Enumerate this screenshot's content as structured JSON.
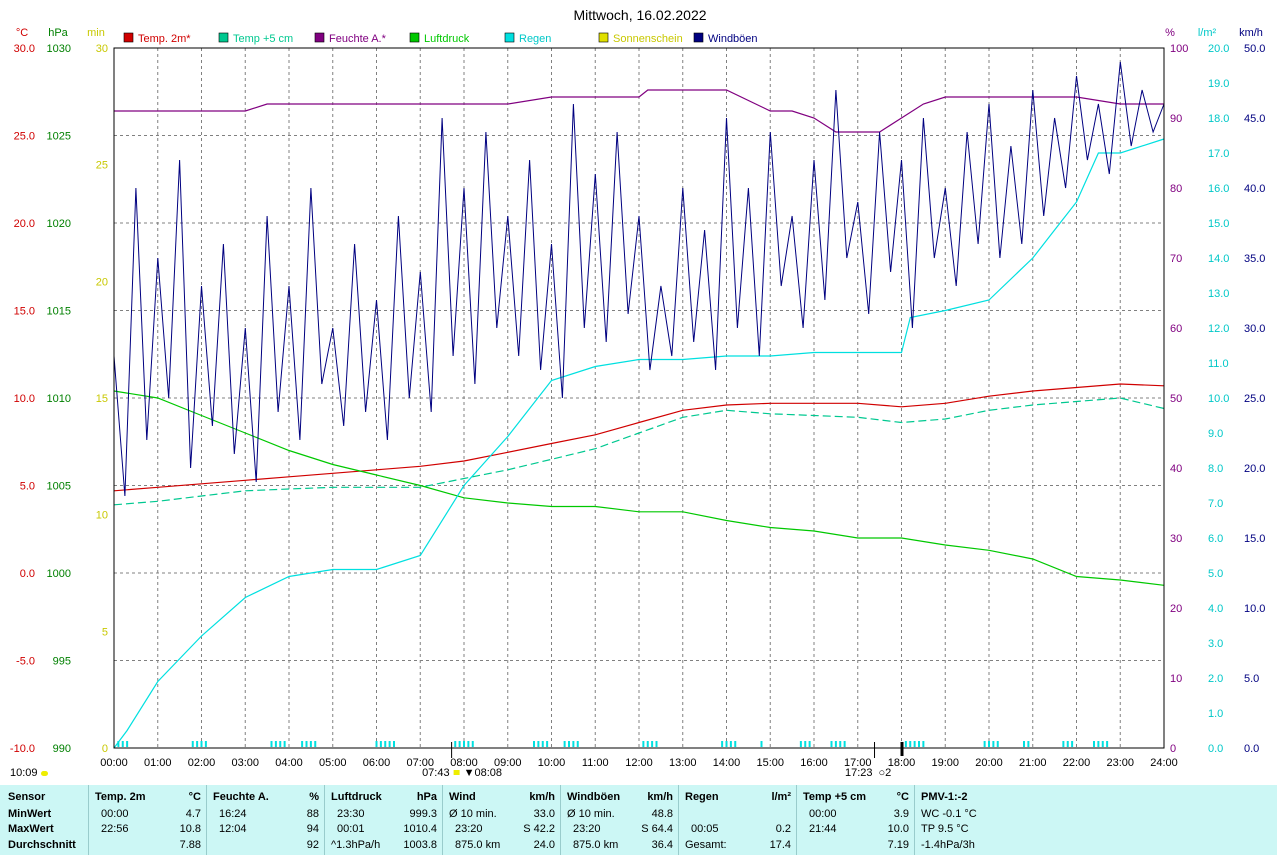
{
  "chart_data": {
    "type": "line",
    "title": "Mittwoch, 16.02.2022",
    "x_ticks": [
      "00:00",
      "01:00",
      "02:00",
      "03:00",
      "04:00",
      "05:00",
      "06:00",
      "07:00",
      "08:00",
      "09:00",
      "10:00",
      "11:00",
      "12:00",
      "13:00",
      "14:00",
      "15:00",
      "16:00",
      "17:00",
      "18:00",
      "19:00",
      "20:00",
      "21:00",
      "22:00",
      "23:00",
      "24:00"
    ],
    "axes": {
      "temp": {
        "unit": "°C",
        "ticks": [
          "30.0",
          "25.0",
          "20.0",
          "15.0",
          "10.0",
          "5.0",
          "0.0",
          "-5.0",
          "-10.0"
        ],
        "range": [
          -10,
          30
        ],
        "color": "#d00000"
      },
      "pressure": {
        "unit": "hPa",
        "ticks": [
          "1030",
          "1025",
          "1020",
          "1015",
          "1010",
          "1005",
          "1000",
          "995",
          "990"
        ],
        "range": [
          990,
          1030
        ],
        "color": "#008000"
      },
      "sun": {
        "unit": "min",
        "ticks": [
          "30",
          "25",
          "20",
          "15",
          "10",
          "5",
          "0"
        ],
        "range": [
          0,
          30
        ],
        "color": "#c8c800"
      },
      "humidity": {
        "unit": "%",
        "ticks": [
          "100",
          "90",
          "80",
          "70",
          "60",
          "50",
          "40",
          "30",
          "20",
          "10",
          "0"
        ],
        "range": [
          0,
          100
        ],
        "color": "#800080"
      },
      "rain": {
        "unit": "l/m²",
        "ticks": [
          "20.0",
          "19.0",
          "18.0",
          "17.0",
          "16.0",
          "15.0",
          "14.0",
          "13.0",
          "12.0",
          "11.0",
          "10.0",
          "9.0",
          "8.0",
          "7.0",
          "6.0",
          "5.0",
          "4.0",
          "3.0",
          "2.0",
          "1.0",
          "0.0"
        ],
        "range": [
          0,
          20
        ],
        "color": "#00c8c8"
      },
      "wind": {
        "unit": "km/h",
        "ticks": [
          "50.0",
          "45.0",
          "40.0",
          "35.0",
          "30.0",
          "25.0",
          "20.0",
          "15.0",
          "10.0",
          "5.0",
          "0.0"
        ],
        "range": [
          0,
          50
        ],
        "color": "#000080"
      }
    },
    "legend": [
      {
        "name": "Temp. 2m*",
        "color": "#d00000"
      },
      {
        "name": "Temp +5 cm",
        "color": "#00c890"
      },
      {
        "name": "Feuchte A.*",
        "color": "#800080"
      },
      {
        "name": "Luftdruck",
        "color": "#00c800"
      },
      {
        "name": "Regen",
        "color": "#00e0e0"
      },
      {
        "name": "Sonnenschein",
        "color": "#e0e000"
      },
      {
        "name": "Windböen",
        "color": "#000080"
      }
    ],
    "series": [
      {
        "name": "Temp. 2m*",
        "axis": "temp",
        "x": [
          0,
          1,
          2,
          3,
          4,
          5,
          6,
          7,
          8,
          9,
          10,
          11,
          12,
          13,
          14,
          15,
          16,
          17,
          18,
          19,
          20,
          21,
          22,
          23,
          24
        ],
        "values": [
          4.7,
          4.9,
          5.1,
          5.3,
          5.5,
          5.7,
          5.9,
          6.1,
          6.4,
          6.9,
          7.4,
          7.9,
          8.6,
          9.3,
          9.6,
          9.7,
          9.7,
          9.7,
          9.5,
          9.7,
          10.1,
          10.4,
          10.6,
          10.8,
          10.7
        ]
      },
      {
        "name": "Temp +5 cm",
        "axis": "temp",
        "x": [
          0,
          1,
          2,
          3,
          4,
          5,
          6,
          7,
          8,
          9,
          10,
          11,
          12,
          13,
          14,
          15,
          16,
          17,
          18,
          19,
          20,
          21,
          22,
          23,
          24
        ],
        "values": [
          3.9,
          4.1,
          4.4,
          4.7,
          4.8,
          4.9,
          4.9,
          4.9,
          5.4,
          5.9,
          6.5,
          7.1,
          8.0,
          8.9,
          9.3,
          9.1,
          9.0,
          8.9,
          8.6,
          8.8,
          9.3,
          9.6,
          9.8,
          10.0,
          9.4
        ]
      },
      {
        "name": "Feuchte A.*",
        "axis": "humidity",
        "x": [
          0,
          1,
          2,
          3,
          3.5,
          4,
          5,
          6,
          7,
          8,
          9,
          10,
          11,
          12,
          12.2,
          13,
          14,
          15,
          15.5,
          16,
          16.5,
          17,
          17.5,
          18,
          18.5,
          19,
          20,
          21,
          22,
          23,
          24
        ],
        "values": [
          91,
          91,
          91,
          91,
          92,
          92,
          92,
          92,
          92,
          92,
          92,
          93,
          93,
          93,
          94,
          94,
          94,
          91,
          91,
          90,
          88,
          88,
          88,
          90,
          92,
          93,
          93,
          93,
          93,
          92,
          92
        ]
      },
      {
        "name": "Luftdruck",
        "axis": "pressure",
        "x": [
          0,
          1,
          2,
          3,
          4,
          5,
          6,
          7,
          8,
          9,
          10,
          11,
          12,
          13,
          14,
          15,
          16,
          17,
          18,
          19,
          20,
          21,
          22,
          23,
          24
        ],
        "values": [
          1010.4,
          1010.0,
          1009.0,
          1008.0,
          1007.0,
          1006.2,
          1005.6,
          1005.0,
          1004.3,
          1004.0,
          1003.8,
          1003.8,
          1003.5,
          1003.5,
          1003.0,
          1002.6,
          1002.4,
          1002.0,
          1002.0,
          1001.6,
          1001.3,
          1000.8,
          999.8,
          999.6,
          999.3
        ]
      },
      {
        "name": "Regen",
        "axis": "rain",
        "x": [
          0,
          0.3,
          1,
          2,
          3,
          4,
          5,
          6,
          7,
          8,
          9,
          10,
          11,
          12,
          13,
          14,
          15,
          16,
          17,
          18,
          18.2,
          19,
          20,
          21,
          21.5,
          22,
          22.5,
          23,
          24
        ],
        "values": [
          0,
          0.5,
          1.9,
          3.2,
          4.3,
          4.9,
          5.1,
          5.1,
          5.5,
          7.5,
          8.9,
          10.5,
          10.9,
          11.1,
          11.1,
          11.2,
          11.2,
          11.3,
          11.3,
          11.3,
          12.3,
          12.5,
          12.8,
          14.0,
          14.8,
          15.6,
          17.0,
          17.0,
          17.4
        ]
      },
      {
        "name": "Windböen",
        "axis": "wind",
        "x": [
          0,
          0.25,
          0.5,
          0.75,
          1,
          1.25,
          1.5,
          1.75,
          2,
          2.25,
          2.5,
          2.75,
          3,
          3.25,
          3.5,
          3.75,
          4,
          4.25,
          4.5,
          4.75,
          5,
          5.25,
          5.5,
          5.75,
          6,
          6.25,
          6.5,
          6.75,
          7,
          7.25,
          7.5,
          7.75,
          8,
          8.25,
          8.5,
          8.75,
          9,
          9.25,
          9.5,
          9.75,
          10,
          10.25,
          10.5,
          10.75,
          11,
          11.25,
          11.5,
          11.75,
          12,
          12.25,
          12.5,
          12.75,
          13,
          13.25,
          13.5,
          13.75,
          14,
          14.25,
          14.5,
          14.75,
          15,
          15.25,
          15.5,
          15.75,
          16,
          16.25,
          16.5,
          16.75,
          17,
          17.25,
          17.5,
          17.75,
          18,
          18.25,
          18.5,
          18.75,
          19,
          19.25,
          19.5,
          19.75,
          20,
          20.25,
          20.5,
          20.75,
          21,
          21.25,
          21.5,
          21.75,
          22,
          22.25,
          22.5,
          22.75,
          23,
          23.25,
          23.5,
          23.75,
          24
        ],
        "values": [
          28,
          18,
          40,
          22,
          35,
          25,
          42,
          20,
          33,
          23,
          36,
          21,
          30,
          19,
          38,
          24,
          33,
          22,
          40,
          26,
          30,
          23,
          36,
          24,
          32,
          22,
          38,
          25,
          34,
          24,
          45,
          28,
          40,
          26,
          44,
          30,
          38,
          28,
          42,
          27,
          36,
          25,
          46,
          30,
          41,
          29,
          44,
          31,
          38,
          27,
          33,
          28,
          40,
          29,
          37,
          27,
          45,
          30,
          40,
          28,
          44,
          33,
          38,
          30,
          42,
          32,
          47,
          35,
          39,
          31,
          44,
          34,
          42,
          30,
          45,
          35,
          40,
          33,
          44,
          36,
          46,
          35,
          43,
          36,
          47,
          38,
          45,
          40,
          48,
          42,
          46,
          41,
          49,
          43,
          47,
          44,
          46
        ]
      }
    ],
    "sun_ticks": {
      "sunrise": "07:43",
      "sunset": "17:23"
    },
    "sun_marker_labels": {
      "left": "▼08:08",
      "right": "○2"
    }
  },
  "corner_time": "10:09",
  "stats": {
    "labels": {
      "sensor": "Sensor",
      "min": "MinWert",
      "max": "MaxWert",
      "avg": "Durchschnitt"
    },
    "temp": {
      "h": "Temp. 2m",
      "u": "°C",
      "min_t": "00:00",
      "min_v": "4.7",
      "max_t": "22:56",
      "max_v": "10.8",
      "avg": "7.88"
    },
    "hum": {
      "h": "Feuchte A.",
      "u": "%",
      "min_t": "16:24",
      "min_v": "88",
      "max_t": "12:04",
      "max_v": "94",
      "avg": "92"
    },
    "press": {
      "h": "Luftdruck",
      "u": "hPa",
      "min_t": "23:30",
      "min_v": "999.3",
      "max_t": "00:01",
      "max_v": "1010.4",
      "avg_t": "^1.3hPa/h",
      "avg": "1003.8"
    },
    "wind": {
      "h": "Wind",
      "u": "km/h",
      "min_t": "Ø 10 min.",
      "min_v": "33.0",
      "max_t": "23:20",
      "max_v": "S 42.2",
      "avg_t": "875.0 km",
      "avg": "24.0"
    },
    "gust": {
      "h": "Windböen",
      "u": "km/h",
      "min_t": "Ø 10 min.",
      "min_v": "48.8",
      "max_t": "23:20",
      "max_v": "S 64.4",
      "avg_t": "875.0 km",
      "avg": "36.4"
    },
    "rain": {
      "h": "Regen",
      "u": "l/m²",
      "max_t": "00:05",
      "max_v": "0.2",
      "avg_t": "Gesamt:",
      "avg": "17.4"
    },
    "t5": {
      "h": "Temp +5 cm",
      "u": "°C",
      "min_t": "00:00",
      "min_v": "3.9",
      "max_t": "21:44",
      "max_v": "10.0",
      "avg": "7.19"
    },
    "pmv": {
      "h": "PMV-1:-2",
      "l1": "WC -0.1 °C",
      "l2": "TP 9.5 °C",
      "l3": "-1.4hPa/3h"
    }
  }
}
